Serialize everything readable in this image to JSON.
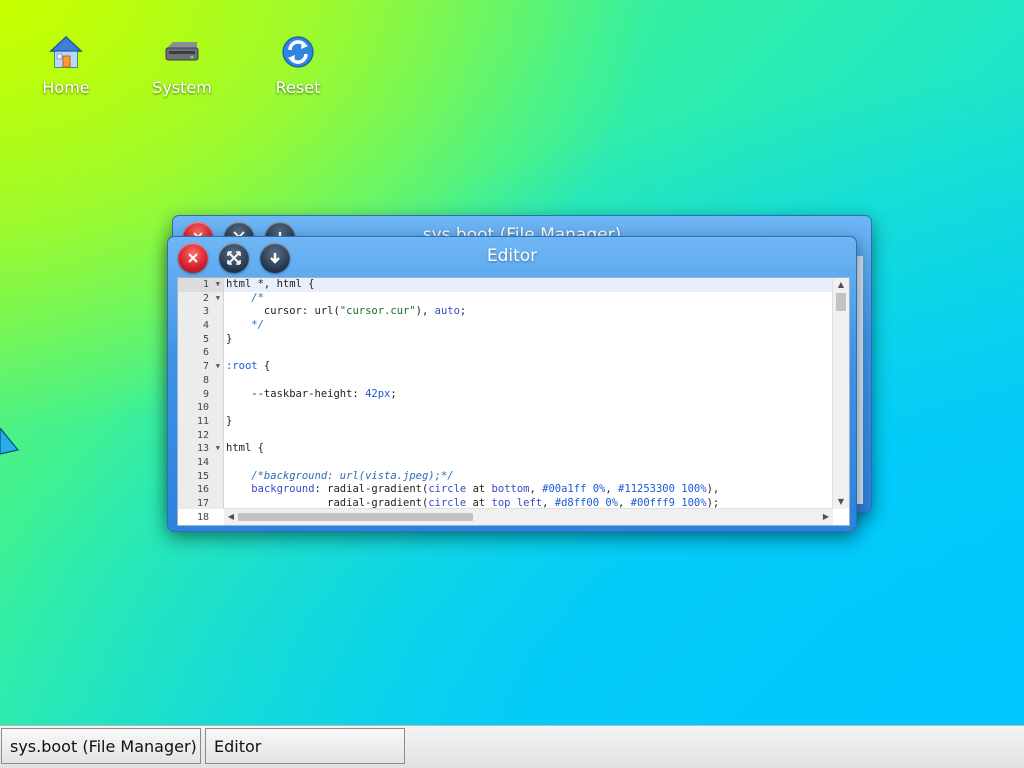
{
  "desktop": {
    "icons": [
      {
        "label": "Home",
        "icon": "home-icon"
      },
      {
        "label": "System",
        "icon": "drive-icon"
      },
      {
        "label": "Reset",
        "icon": "refresh-icon"
      }
    ]
  },
  "windows": {
    "file_manager": {
      "title": "sys.boot (File Manager)"
    },
    "editor": {
      "title": "Editor",
      "lines": [
        {
          "n": "1",
          "fold": true,
          "code": "html *, html {"
        },
        {
          "n": "2",
          "fold": true,
          "code": "    /*"
        },
        {
          "n": "3",
          "fold": false,
          "code": "      cursor: url(\"cursor.cur\"), auto;"
        },
        {
          "n": "4",
          "fold": false,
          "code": "    */"
        },
        {
          "n": "5",
          "fold": false,
          "code": "}"
        },
        {
          "n": "6",
          "fold": false,
          "code": ""
        },
        {
          "n": "7",
          "fold": true,
          "code": ":root {"
        },
        {
          "n": "8",
          "fold": false,
          "code": ""
        },
        {
          "n": "9",
          "fold": false,
          "code": "    --taskbar-height: 42px;"
        },
        {
          "n": "10",
          "fold": false,
          "code": ""
        },
        {
          "n": "11",
          "fold": false,
          "code": "}"
        },
        {
          "n": "12",
          "fold": false,
          "code": ""
        },
        {
          "n": "13",
          "fold": true,
          "code": "html {"
        },
        {
          "n": "14",
          "fold": false,
          "code": ""
        },
        {
          "n": "15",
          "fold": false,
          "code": "    /*background: url(vista.jpeg);*/"
        },
        {
          "n": "16",
          "fold": false,
          "code": "    background: radial-gradient(circle at bottom, #00a1ff 0%, #11253300 100%),"
        },
        {
          "n": "17",
          "fold": false,
          "code": "                radial-gradient(circle at top left, #d8ff00 0%, #00fff9 100%);"
        },
        {
          "n": "18",
          "fold": false,
          "code": ""
        }
      ]
    }
  },
  "taskbar": {
    "items": [
      {
        "label": "sys.boot (File Manager)"
      },
      {
        "label": "Editor"
      }
    ]
  },
  "colors": {
    "window_blue": "#3f93e6",
    "close_red": "#d21f2b",
    "taskbar_bg": "#e2e2e2"
  }
}
